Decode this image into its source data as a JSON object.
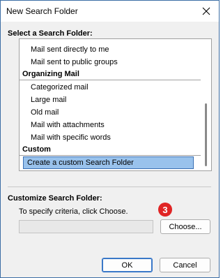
{
  "window": {
    "title": "New Search Folder"
  },
  "select_section": {
    "label": "Select a Search Folder:"
  },
  "list": {
    "rows": [
      {
        "kind": "item",
        "label": "Mail sent directly to me"
      },
      {
        "kind": "item",
        "label": "Mail sent to public groups"
      },
      {
        "kind": "header",
        "label": "Organizing Mail"
      },
      {
        "kind": "item",
        "label": "Categorized mail"
      },
      {
        "kind": "item",
        "label": "Large mail"
      },
      {
        "kind": "item",
        "label": "Old mail"
      },
      {
        "kind": "item",
        "label": "Mail with attachments"
      },
      {
        "kind": "item",
        "label": "Mail with specific words"
      },
      {
        "kind": "header",
        "label": "Custom"
      },
      {
        "kind": "item",
        "label": "Create a custom Search Folder",
        "selected": true
      }
    ]
  },
  "customize_section": {
    "label": "Customize Search Folder:",
    "criteria_text": "To specify criteria, click Choose.",
    "criteria_value": "",
    "choose_label": "Choose..."
  },
  "step_badge": {
    "number": "3",
    "color": "#e02424"
  },
  "footer": {
    "ok_label": "OK",
    "cancel_label": "Cancel"
  },
  "icons": {
    "close": "close-icon"
  },
  "colors": {
    "selection_fill": "#99c2ec",
    "selection_border": "#3a70b4",
    "accent": "#3a78c8"
  }
}
